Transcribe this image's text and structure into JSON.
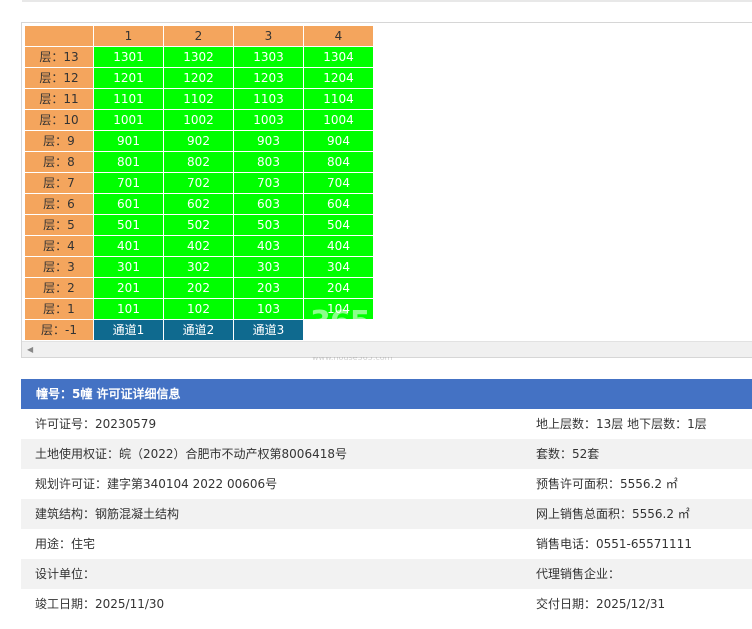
{
  "grid": {
    "columns": [
      "",
      "1",
      "2",
      "3",
      "4"
    ],
    "rows": [
      {
        "floor": "层：13",
        "units": [
          "1301",
          "1302",
          "1303",
          "1304"
        ]
      },
      {
        "floor": "层：12",
        "units": [
          "1201",
          "1202",
          "1203",
          "1204"
        ]
      },
      {
        "floor": "层：11",
        "units": [
          "1101",
          "1102",
          "1103",
          "1104"
        ]
      },
      {
        "floor": "层：10",
        "units": [
          "1001",
          "1002",
          "1003",
          "1004"
        ]
      },
      {
        "floor": "层：9",
        "units": [
          "901",
          "902",
          "903",
          "904"
        ]
      },
      {
        "floor": "层：8",
        "units": [
          "801",
          "802",
          "803",
          "804"
        ]
      },
      {
        "floor": "层：7",
        "units": [
          "701",
          "702",
          "703",
          "704"
        ]
      },
      {
        "floor": "层：6",
        "units": [
          "601",
          "602",
          "603",
          "604"
        ]
      },
      {
        "floor": "层：5",
        "units": [
          "501",
          "502",
          "503",
          "504"
        ]
      },
      {
        "floor": "层：4",
        "units": [
          "401",
          "402",
          "403",
          "404"
        ]
      },
      {
        "floor": "层：3",
        "units": [
          "301",
          "302",
          "303",
          "304"
        ]
      },
      {
        "floor": "层：2",
        "units": [
          "201",
          "202",
          "203",
          "204"
        ]
      },
      {
        "floor": "层：1",
        "units": [
          "101",
          "102",
          "103",
          "104"
        ]
      }
    ],
    "basement": {
      "floor": "层：-1",
      "passages": [
        "通道1",
        "通道2",
        "通道3",
        ""
      ]
    },
    "colors": {
      "floor_bg": "#f4a55d",
      "unit_bg": "#00ff00",
      "passage_bg": "#0f6a8f"
    },
    "watermark": "365",
    "watermark_sub": "www.house365.com"
  },
  "info": {
    "header": "幢号：5幢 许可证详细信息",
    "rows": [
      {
        "left": "许可证号：20230579",
        "right": "地上层数：13层  地下层数：1层"
      },
      {
        "left": "土地使用权证：皖（2022）合肥市不动产权第8006418号",
        "right": "套数：52套"
      },
      {
        "left": "规划许可证：建字第340104 2022 00606号",
        "right": "预售许可面积：5556.2 ㎡"
      },
      {
        "left": "建筑结构：钢筋混凝土结构",
        "right": "网上销售总面积：5556.2 ㎡"
      },
      {
        "left": "用途：住宅",
        "right": "销售电话：0551-65571111"
      },
      {
        "left": "设计单位：",
        "right": "代理销售企业："
      },
      {
        "left": "竣工日期：2025/11/30",
        "right": "交付日期：2025/12/31"
      }
    ]
  }
}
